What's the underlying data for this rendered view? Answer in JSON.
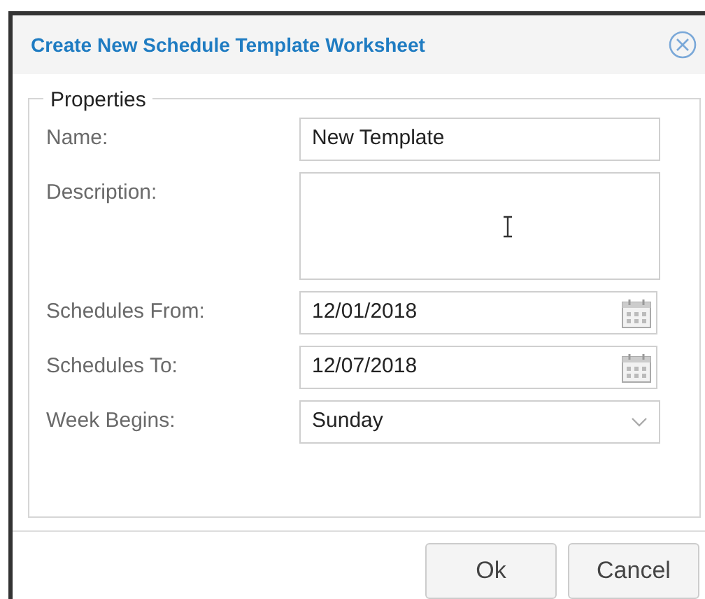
{
  "dialog": {
    "title": "Create New Schedule Template Worksheet"
  },
  "fieldset": {
    "legend": "Properties"
  },
  "fields": [
    {
      "kind": "text",
      "label": "Name:",
      "value": "New Template"
    },
    {
      "kind": "textarea",
      "label": "Description:"
    },
    {
      "kind": "date",
      "label": "Schedules From:",
      "value": "12/01/2018"
    },
    {
      "kind": "date",
      "label": "Schedules To:",
      "value": "12/07/2018"
    },
    {
      "kind": "select",
      "label": "Week Begins:",
      "value": "Sunday"
    }
  ],
  "buttons": [
    "Ok",
    "Cancel"
  ]
}
